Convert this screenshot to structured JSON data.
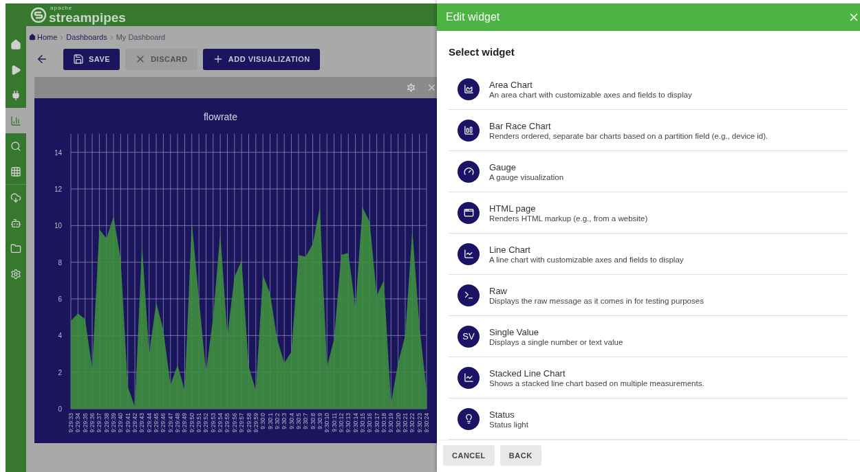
{
  "app": {
    "logo_small": "apache",
    "logo": "streampipes"
  },
  "sidebar": {
    "items": [
      {
        "selected": false
      },
      {
        "selected": false
      },
      {
        "selected": false
      },
      {
        "selected": true
      },
      {
        "selected": false
      },
      {
        "selected": false
      },
      {
        "selected": false
      },
      {
        "selected": false
      },
      {
        "selected": false
      },
      {
        "selected": false
      }
    ]
  },
  "breadcrumb": [
    "Home",
    "Dashboards",
    "My Dashboard"
  ],
  "toolbar": {
    "buttons": [
      {
        "label": "SAVE",
        "kind": "primary"
      },
      {
        "label": "DISCARD",
        "kind": "flat"
      },
      {
        "label": "ADD VISUALIZATION",
        "kind": "primary"
      }
    ]
  },
  "widget": {
    "chart_data": {
      "type": "area",
      "title": "flowrate",
      "categories": [
        "9:29:33",
        "9:29:34",
        "9:29:35",
        "9:29:36",
        "9:29:37",
        "9:29:38",
        "9:29:39",
        "9:29:40",
        "9:29:41",
        "9:29:42",
        "9:29:43",
        "9:29:44",
        "9:29:45",
        "9:29:46",
        "9:29:47",
        "9:29:48",
        "9:29:49",
        "9:29:50",
        "9:29:51",
        "9:29:52",
        "9:29:53",
        "9:29:54",
        "9:29:55",
        "9:29:56",
        "9:29:57",
        "9:29:58",
        "9:29:59",
        "9:30:0",
        "9:30:1",
        "9:30:2",
        "9:30:3",
        "9:30:4",
        "9:30:5",
        "9:30:7",
        "9:30:8",
        "9:30:9",
        "9:30:10",
        "9:30:11",
        "9:30:12",
        "9:30:13",
        "9:30:14",
        "9:30:15",
        "9:30:16",
        "9:30:17",
        "9:30:18",
        "9:30:19",
        "9:30:20",
        "9:30:21",
        "9:30:22",
        "9:30:23",
        "9:30:24"
      ],
      "series": [
        {
          "color": "#3e8e3e",
          "values": [
            4.8,
            5.2,
            4.9,
            2.2,
            9.8,
            9.3,
            10.5,
            8.2,
            1.2,
            0.1,
            9.0,
            3.0,
            5.8,
            4.3,
            1.3,
            2.4,
            1.0,
            10.2,
            6.0,
            2.0,
            5.0,
            9.6,
            4.0,
            7.2,
            8.1,
            2.3,
            1.0,
            7.3,
            6.3,
            3.8,
            2.5,
            3.1,
            8.4,
            8.3,
            9.0,
            11.0,
            2.3,
            3.8,
            8.4,
            8.5,
            5.5,
            11.0,
            10.2,
            6.2,
            7.0,
            0.3,
            2.5,
            4.0,
            9.8,
            4.5,
            1.0
          ]
        }
      ],
      "yticks": [
        0,
        2,
        4,
        6,
        8,
        10,
        12,
        14
      ],
      "ylim": [
        0,
        15
      ],
      "grid": true
    }
  },
  "dialog": {
    "title": "Edit widget",
    "heading": "Select widget",
    "items": [
      {
        "title": "Area Chart",
        "description": "An area chart with customizable axes and fields to display"
      },
      {
        "title": "Bar Race Chart",
        "description": "Renders ordered, separate bar charts based on a partition field (e.g., device id)."
      },
      {
        "title": "Gauge",
        "description": "A gauge visualization"
      },
      {
        "title": "HTML page",
        "description": "Renders HTML markup (e.g., from a website)"
      },
      {
        "title": "Line Chart",
        "description": "A line chart with customizable axes and fields to display"
      },
      {
        "title": "Raw",
        "description": "Displays the raw message as it comes in for testing purposes"
      },
      {
        "title": "Single Value",
        "description": "Displays a single number or text value",
        "badge": "SV"
      },
      {
        "title": "Stacked Line Chart",
        "description": "Shows a stacked line chart based on multiple measurements."
      },
      {
        "title": "Status",
        "description": "Status light"
      }
    ],
    "buttons": [
      "CANCEL",
      "BACK"
    ]
  }
}
